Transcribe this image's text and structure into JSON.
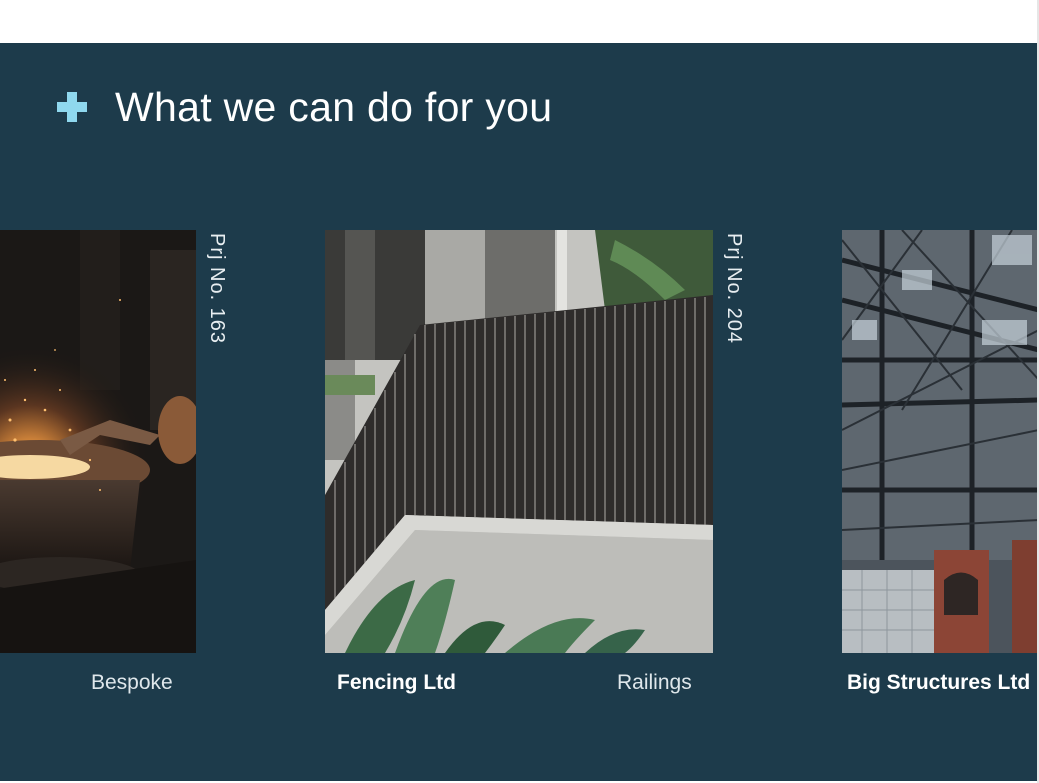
{
  "header": {
    "title": "What we can do for you",
    "icon": "plus-icon",
    "accent_color": "#8fd8ee",
    "background_color": "#1d3b4b"
  },
  "projects": [
    {
      "project_number": "Prj No. 163",
      "caption_light": "Bespoke",
      "image": "welding-sparks-photo"
    },
    {
      "project_number": "Prj No. 204",
      "caption_bold": "Fencing Ltd",
      "caption_light": "Railings",
      "image": "metal-railings-photo"
    },
    {
      "caption_bold": "Big Structures Ltd",
      "image": "steel-roof-structure-photo"
    }
  ]
}
